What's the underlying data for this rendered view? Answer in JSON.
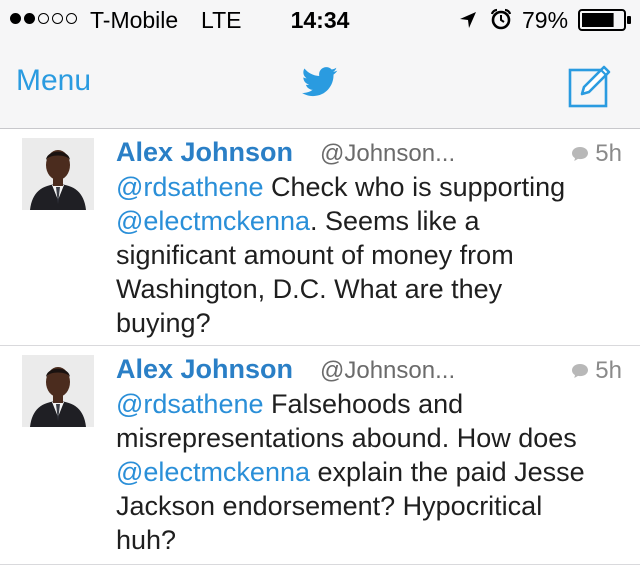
{
  "status_bar": {
    "carrier": "T-Mobile",
    "network": "LTE",
    "time": "14:34",
    "battery": "79%",
    "battery_level": 0.79,
    "signal_strength": 2,
    "signal_max": 5
  },
  "nav": {
    "menu_label": "Menu",
    "logo_icon": "twitter-bird-icon",
    "compose_icon": "compose-icon"
  },
  "colors": {
    "accent": "#2a9be0",
    "name": "#2a7fc6",
    "mention": "#2a8fd8"
  },
  "tweets": [
    {
      "name": "Alex Johnson",
      "handle": "@Johnson...",
      "time": "5h",
      "lines": [
        {
          "mention": "@rdsathene",
          "text": " Check who is supporting"
        },
        {
          "mention": "@electmckenna",
          "text": ". Seems like a"
        },
        {
          "mention": "",
          "text": "significant amount of money from"
        },
        {
          "mention": "",
          "text": "Washington, D.C. What are they"
        },
        {
          "mention": "",
          "text": "buying?"
        }
      ]
    },
    {
      "name": "Alex Johnson",
      "handle": "@Johnson...",
      "time": "5h",
      "lines": [
        {
          "mention": "@rdsathene",
          "text": " Falsehoods and"
        },
        {
          "mention": "",
          "text": "misrepresentations abound. How does"
        },
        {
          "mention": "@electmckenna",
          "text": " explain the paid Jesse"
        },
        {
          "mention": "",
          "text": "Jackson endorsement? Hypocritical"
        },
        {
          "mention": "",
          "text": "huh?"
        }
      ]
    }
  ]
}
